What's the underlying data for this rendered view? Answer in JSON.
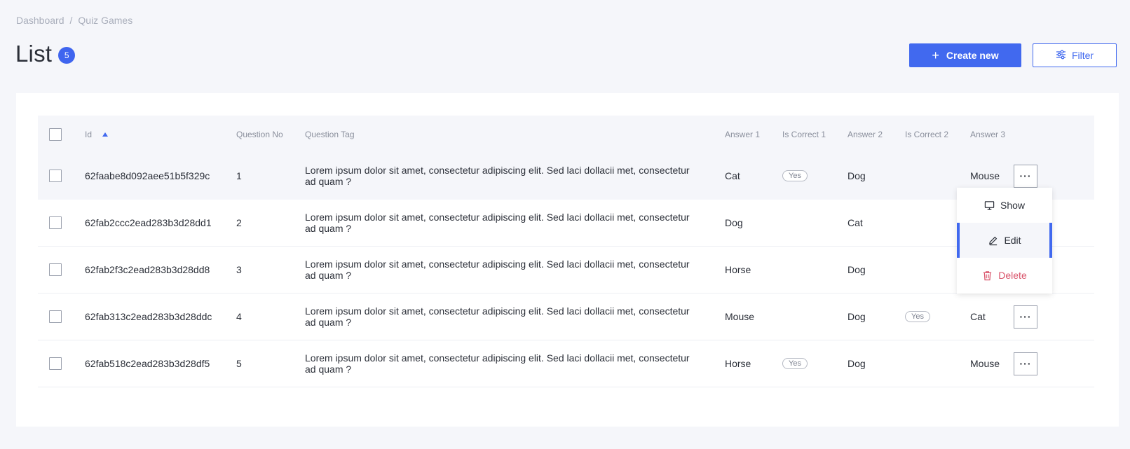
{
  "breadcrumb": {
    "items": [
      "Dashboard",
      "Quiz Games"
    ],
    "separator": "/"
  },
  "page": {
    "title": "List",
    "count": "5"
  },
  "actions": {
    "create_label": "Create new",
    "filter_label": "Filter"
  },
  "table": {
    "headers": {
      "id": "Id",
      "question_no": "Question No",
      "question_tag": "Question Tag",
      "answer_1": "Answer 1",
      "is_correct_1": "Is Correct 1",
      "answer_2": "Answer 2",
      "is_correct_2": "Is Correct 2",
      "answer_3": "Answer 3"
    },
    "sort": {
      "column": "Id",
      "direction": "ascending"
    },
    "rows": [
      {
        "id": "62faabe8d092aee51b5f329c",
        "question_no": "1",
        "question_tag": "Lorem ipsum dolor sit amet, consectetur adipiscing elit. Sed laci dollacii met, consectetur ad quam ?",
        "answer_1": "Cat",
        "is_correct_1": "Yes",
        "answer_2": "Dog",
        "is_correct_2": "",
        "answer_3": "Mouse",
        "more": "···"
      },
      {
        "id": "62fab2ccc2ead283b3d28dd1",
        "question_no": "2",
        "question_tag": "Lorem ipsum dolor sit amet, consectetur adipiscing elit. Sed laci dollacii met, consectetur ad quam ?",
        "answer_1": "Dog",
        "is_correct_1": "",
        "answer_2": "Cat",
        "is_correct_2": "",
        "answer_3": "",
        "more": ""
      },
      {
        "id": "62fab2f3c2ead283b3d28dd8",
        "question_no": "3",
        "question_tag": "Lorem ipsum dolor sit amet, consectetur adipiscing elit. Sed laci dollacii met, consectetur ad quam ?",
        "answer_1": "Horse",
        "is_correct_1": "",
        "answer_2": "Dog",
        "is_correct_2": "",
        "answer_3": "",
        "more": ""
      },
      {
        "id": "62fab313c2ead283b3d28ddc",
        "question_no": "4",
        "question_tag": "Lorem ipsum dolor sit amet, consectetur adipiscing elit. Sed laci dollacii met, consectetur ad quam ?",
        "answer_1": "Mouse",
        "is_correct_1": "",
        "answer_2": "Dog",
        "is_correct_2": "Yes",
        "answer_3": "Cat",
        "more": "···"
      },
      {
        "id": "62fab518c2ead283b3d28df5",
        "question_no": "5",
        "question_tag": "Lorem ipsum dolor sit amet, consectetur adipiscing elit. Sed laci dollacii met, consectetur ad quam ?",
        "answer_1": "Horse",
        "is_correct_1": "Yes",
        "answer_2": "Dog",
        "is_correct_2": "",
        "answer_3": "Mouse",
        "more": "···"
      }
    ]
  },
  "row_menu": {
    "items": [
      {
        "label": "Show",
        "icon": "monitor-icon"
      },
      {
        "label": "Edit",
        "icon": "pencil-icon"
      },
      {
        "label": "Delete",
        "icon": "trash-icon"
      }
    ]
  },
  "colors": {
    "accent": "#4169ef",
    "danger": "#d9536a",
    "background": "#f5f6fa"
  }
}
